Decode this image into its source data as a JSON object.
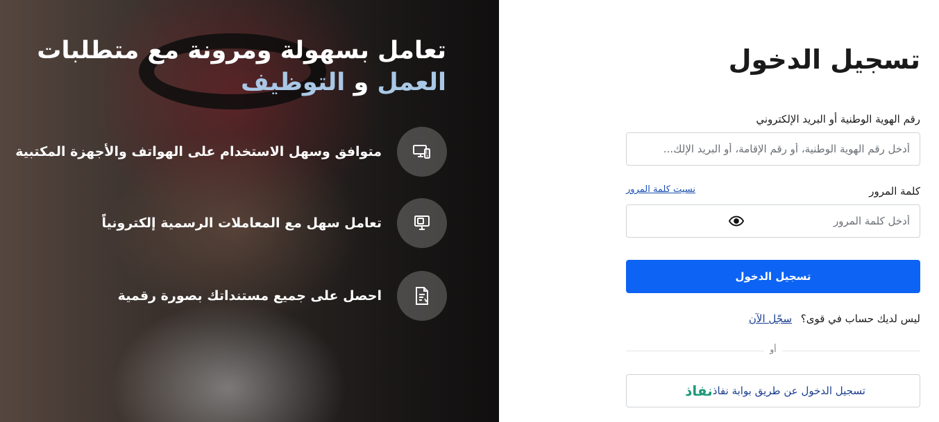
{
  "hero": {
    "title_line1": "تعامل بسهولة ومرونة مع متطلبات",
    "title_accent1": "العمل",
    "title_joiner": "و",
    "title_accent2": "التوظيف",
    "features": [
      {
        "text": "متوافق وسهل الاستخدام على الهواتف والأجهزة المكتبية",
        "icon": "devices-icon"
      },
      {
        "text": "تعامل سهل مع المعاملات الرسمية إلكترونياً",
        "icon": "desktop-icon"
      },
      {
        "text": "احصل على جميع مستنداتك بصورة رقمية",
        "icon": "document-icon"
      }
    ],
    "accent_color": "#a9c8e6"
  },
  "login": {
    "title": "تسجيل الدخول",
    "id_label": "رقم الهوية الوطنية أو البريد الإلكتروني",
    "id_placeholder": "أدخل رقم الهوية الوطنية، أو رقم الإقامة، أو البريد الإلك...",
    "id_value": "",
    "password_label": "كلمة المرور",
    "forgot_link": "نسيت كلمة المرور",
    "password_placeholder": "أدخل كلمة المرور",
    "password_value": "",
    "submit_label": "تسجيل الدخول",
    "no_account_text": "ليس لديك حساب في قوى؟",
    "register_link": "سجّل الآن",
    "or_text": "أو",
    "nafath_logo": "نفاذ",
    "nafath_label": "تسجيل الدخول عن طريق بوابة نفاذ",
    "primary_color": "#0d63f3",
    "nafath_color": "#1f9a7a"
  }
}
